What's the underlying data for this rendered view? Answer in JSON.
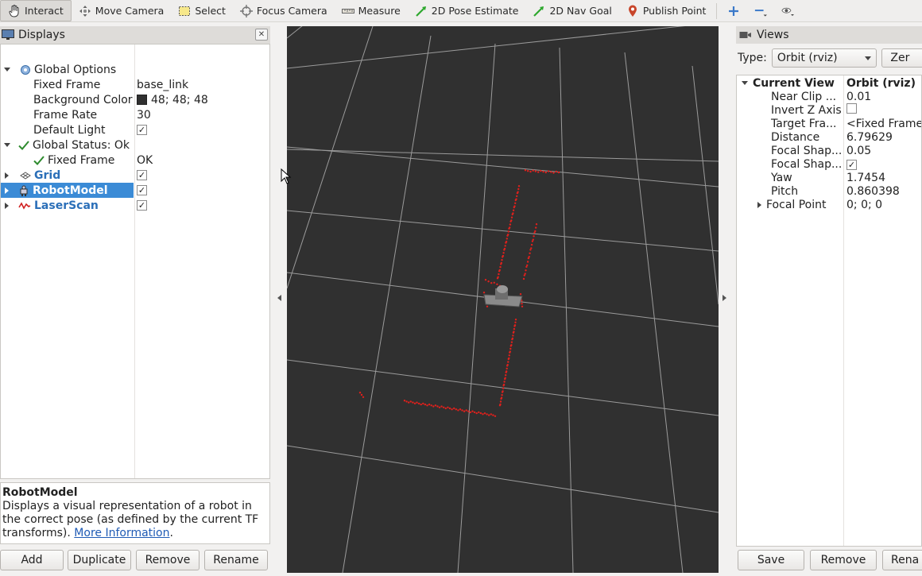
{
  "toolbar": {
    "interact": "Interact",
    "move_camera": "Move Camera",
    "select": "Select",
    "focus_camera": "Focus Camera",
    "measure": "Measure",
    "pose_estimate": "2D Pose Estimate",
    "nav_goal": "2D Nav Goal",
    "publish_point": "Publish Point"
  },
  "displays": {
    "title": "Displays",
    "global_options": "Global Options",
    "fixed_frame_label": "Fixed Frame",
    "fixed_frame_value": "base_link",
    "background_color_label": "Background Color",
    "background_color_value": "48; 48; 48",
    "frame_rate_label": "Frame Rate",
    "frame_rate_value": "30",
    "default_light_label": "Default Light",
    "global_status": "Global Status: Ok",
    "status_fixed_frame_label": "Fixed Frame",
    "status_fixed_frame_value": "OK",
    "grid": "Grid",
    "robot_model": "RobotModel",
    "laser_scan": "LaserScan",
    "check": "✓"
  },
  "description": {
    "title": "RobotModel",
    "text": "Displays a visual representation of a robot in the correct pose (as defined by the current TF transforms).",
    "link": "More Information",
    "trailing": "."
  },
  "buttons": {
    "add": "Add",
    "duplicate": "Duplicate",
    "remove": "Remove",
    "rename": "Rename"
  },
  "views": {
    "title": "Views",
    "type_label": "Type:",
    "type_value": "Orbit (rviz)",
    "zero_label": "Zer",
    "current_view_label": "Current View",
    "current_view_value": "Orbit (rviz)",
    "props": [
      {
        "label": "Near Clip ...",
        "value": "0.01"
      },
      {
        "label": "Invert Z Axis",
        "value": ""
      },
      {
        "label": "Target Fra...",
        "value": "<Fixed Frame>"
      },
      {
        "label": "Distance",
        "value": "6.79629"
      },
      {
        "label": "Focal Shap...",
        "value": "0.05"
      },
      {
        "label": "Focal Shap...",
        "value": "✓"
      },
      {
        "label": "Yaw",
        "value": "1.7454"
      },
      {
        "label": "Pitch",
        "value": "0.860398"
      },
      {
        "label": "Focal Point",
        "value": "0; 0; 0"
      }
    ],
    "save": "Save",
    "remove": "Remove",
    "rename": "Rena"
  },
  "colors": {
    "viewport_bg": "#303030",
    "grid_line": "#9a9a9a",
    "laser": "#e0201c",
    "selection": "#3b8bd6"
  }
}
